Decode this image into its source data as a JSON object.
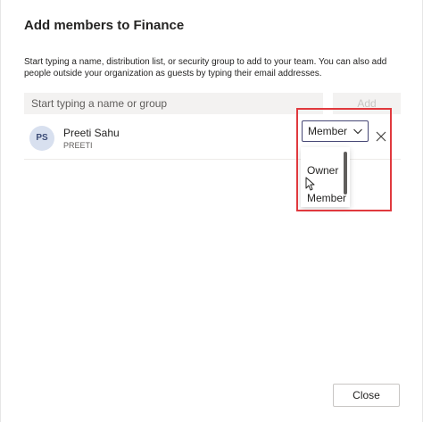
{
  "dialog": {
    "title": "Add members to Finance",
    "description": "Start typing a name, distribution list, or security group to add to your team. You can also add people outside your organization as guests by typing their email addresses."
  },
  "search": {
    "placeholder": "Start typing a name or group",
    "value": ""
  },
  "add_button": {
    "label": "Add"
  },
  "member": {
    "avatar_initials": "PS",
    "name": "Preeti Sahu",
    "subtitle": "PREETI",
    "role": "Member"
  },
  "role_menu": {
    "options": [
      "Owner",
      "Member"
    ]
  },
  "footer": {
    "close_label": "Close"
  },
  "icons": {
    "role_chevron": "chevron-down-icon",
    "remove": "close-icon",
    "cursor": "mouse-pointer-icon"
  },
  "colors": {
    "accent": "#464775",
    "highlight": "#e0393e",
    "avatar_bg": "#d8e0ef"
  }
}
